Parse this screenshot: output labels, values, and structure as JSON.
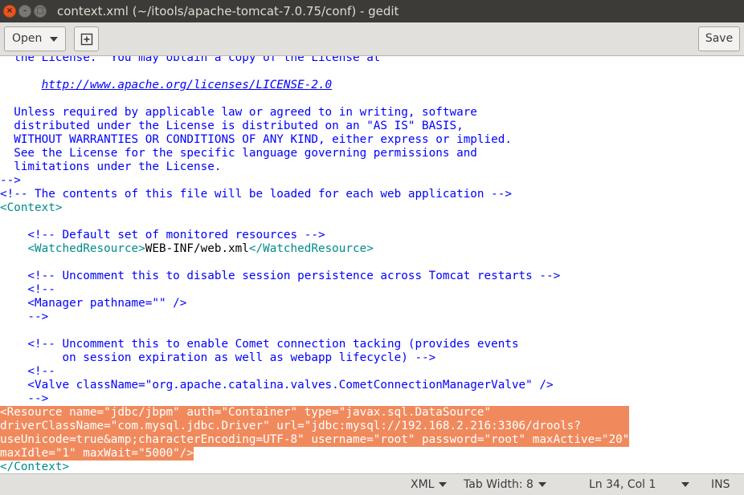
{
  "window": {
    "title": "context.xml (~/itools/apache-tomcat-7.0.75/conf) - gedit",
    "close_glyph": "×",
    "minimize_glyph": "–",
    "maximize_glyph": "□"
  },
  "toolbar": {
    "open_label": "Open",
    "save_label": "Save"
  },
  "editor": {
    "lines": [
      {
        "text": "  the License.  You may obtain a copy of the License at",
        "kind": "comment"
      },
      {
        "text": "",
        "kind": "plain"
      },
      {
        "text": "      http://www.apache.org/licenses/LICENSE-2.0",
        "kind": "link"
      },
      {
        "text": "",
        "kind": "plain"
      },
      {
        "text": "  Unless required by applicable law or agreed to in writing, software",
        "kind": "comment"
      },
      {
        "text": "  distributed under the License is distributed on an \"AS IS\" BASIS,",
        "kind": "comment"
      },
      {
        "text": "  WITHOUT WARRANTIES OR CONDITIONS OF ANY KIND, either express or implied.",
        "kind": "comment"
      },
      {
        "text": "  See the License for the specific language governing permissions and",
        "kind": "comment"
      },
      {
        "text": "  limitations under the License.",
        "kind": "comment"
      },
      {
        "text": "-->",
        "kind": "comment"
      },
      {
        "text": "<!-- The contents of this file will be loaded for each web application -->",
        "kind": "comment"
      },
      {
        "text": "<Context>",
        "kind": "tag"
      },
      {
        "text": "",
        "kind": "plain"
      },
      {
        "text": "    <!-- Default set of monitored resources -->",
        "kind": "comment"
      },
      {
        "text": "    <WatchedResource>WEB-INF/web.xml</WatchedResource>",
        "kind": "watched"
      },
      {
        "text": "",
        "kind": "plain"
      },
      {
        "text": "    <!-- Uncomment this to disable session persistence across Tomcat restarts -->",
        "kind": "comment"
      },
      {
        "text": "    <!--",
        "kind": "comment"
      },
      {
        "text": "    <Manager pathname=\"\" />",
        "kind": "comment"
      },
      {
        "text": "    -->",
        "kind": "comment"
      },
      {
        "text": "",
        "kind": "plain"
      },
      {
        "text": "    <!-- Uncomment this to enable Comet connection tacking (provides events",
        "kind": "comment"
      },
      {
        "text": "         on session expiration as well as webapp lifecycle) -->",
        "kind": "comment"
      },
      {
        "text": "    <!--",
        "kind": "comment"
      },
      {
        "text": "    <Valve className=\"org.apache.catalina.valves.CometConnectionManagerValve\" />",
        "kind": "comment"
      },
      {
        "text": "    -->",
        "kind": "comment"
      },
      {
        "text": "<Resource name=\"jdbc/jbpm\" auth=\"Container\" type=\"javax.sql.DataSource\"",
        "kind": "selected"
      },
      {
        "text": "driverClassName=\"com.mysql.jdbc.Driver\" url=\"jdbc:mysql://192.168.2.216:3306/drools?",
        "kind": "selected"
      },
      {
        "text": "useUnicode=true&amp;characterEncoding=UTF-8\" username=\"root\" password=\"root\" maxActive=\"20\"",
        "kind": "selected"
      },
      {
        "text": "maxIdle=\"1\" maxWait=\"5000\"/>",
        "kind": "selected-last"
      },
      {
        "text": "</Context>",
        "kind": "tag"
      }
    ]
  },
  "statusbar": {
    "language": "XML",
    "tab_width": "Tab Width: 8",
    "position": "Ln 34, Col 1",
    "mode": "INS"
  },
  "colors": {
    "titlebar": "#3c3b37",
    "close_button": "#e95420",
    "comment": "#0000ff",
    "tag": "#008a8c",
    "selection": "#f08a5d"
  }
}
